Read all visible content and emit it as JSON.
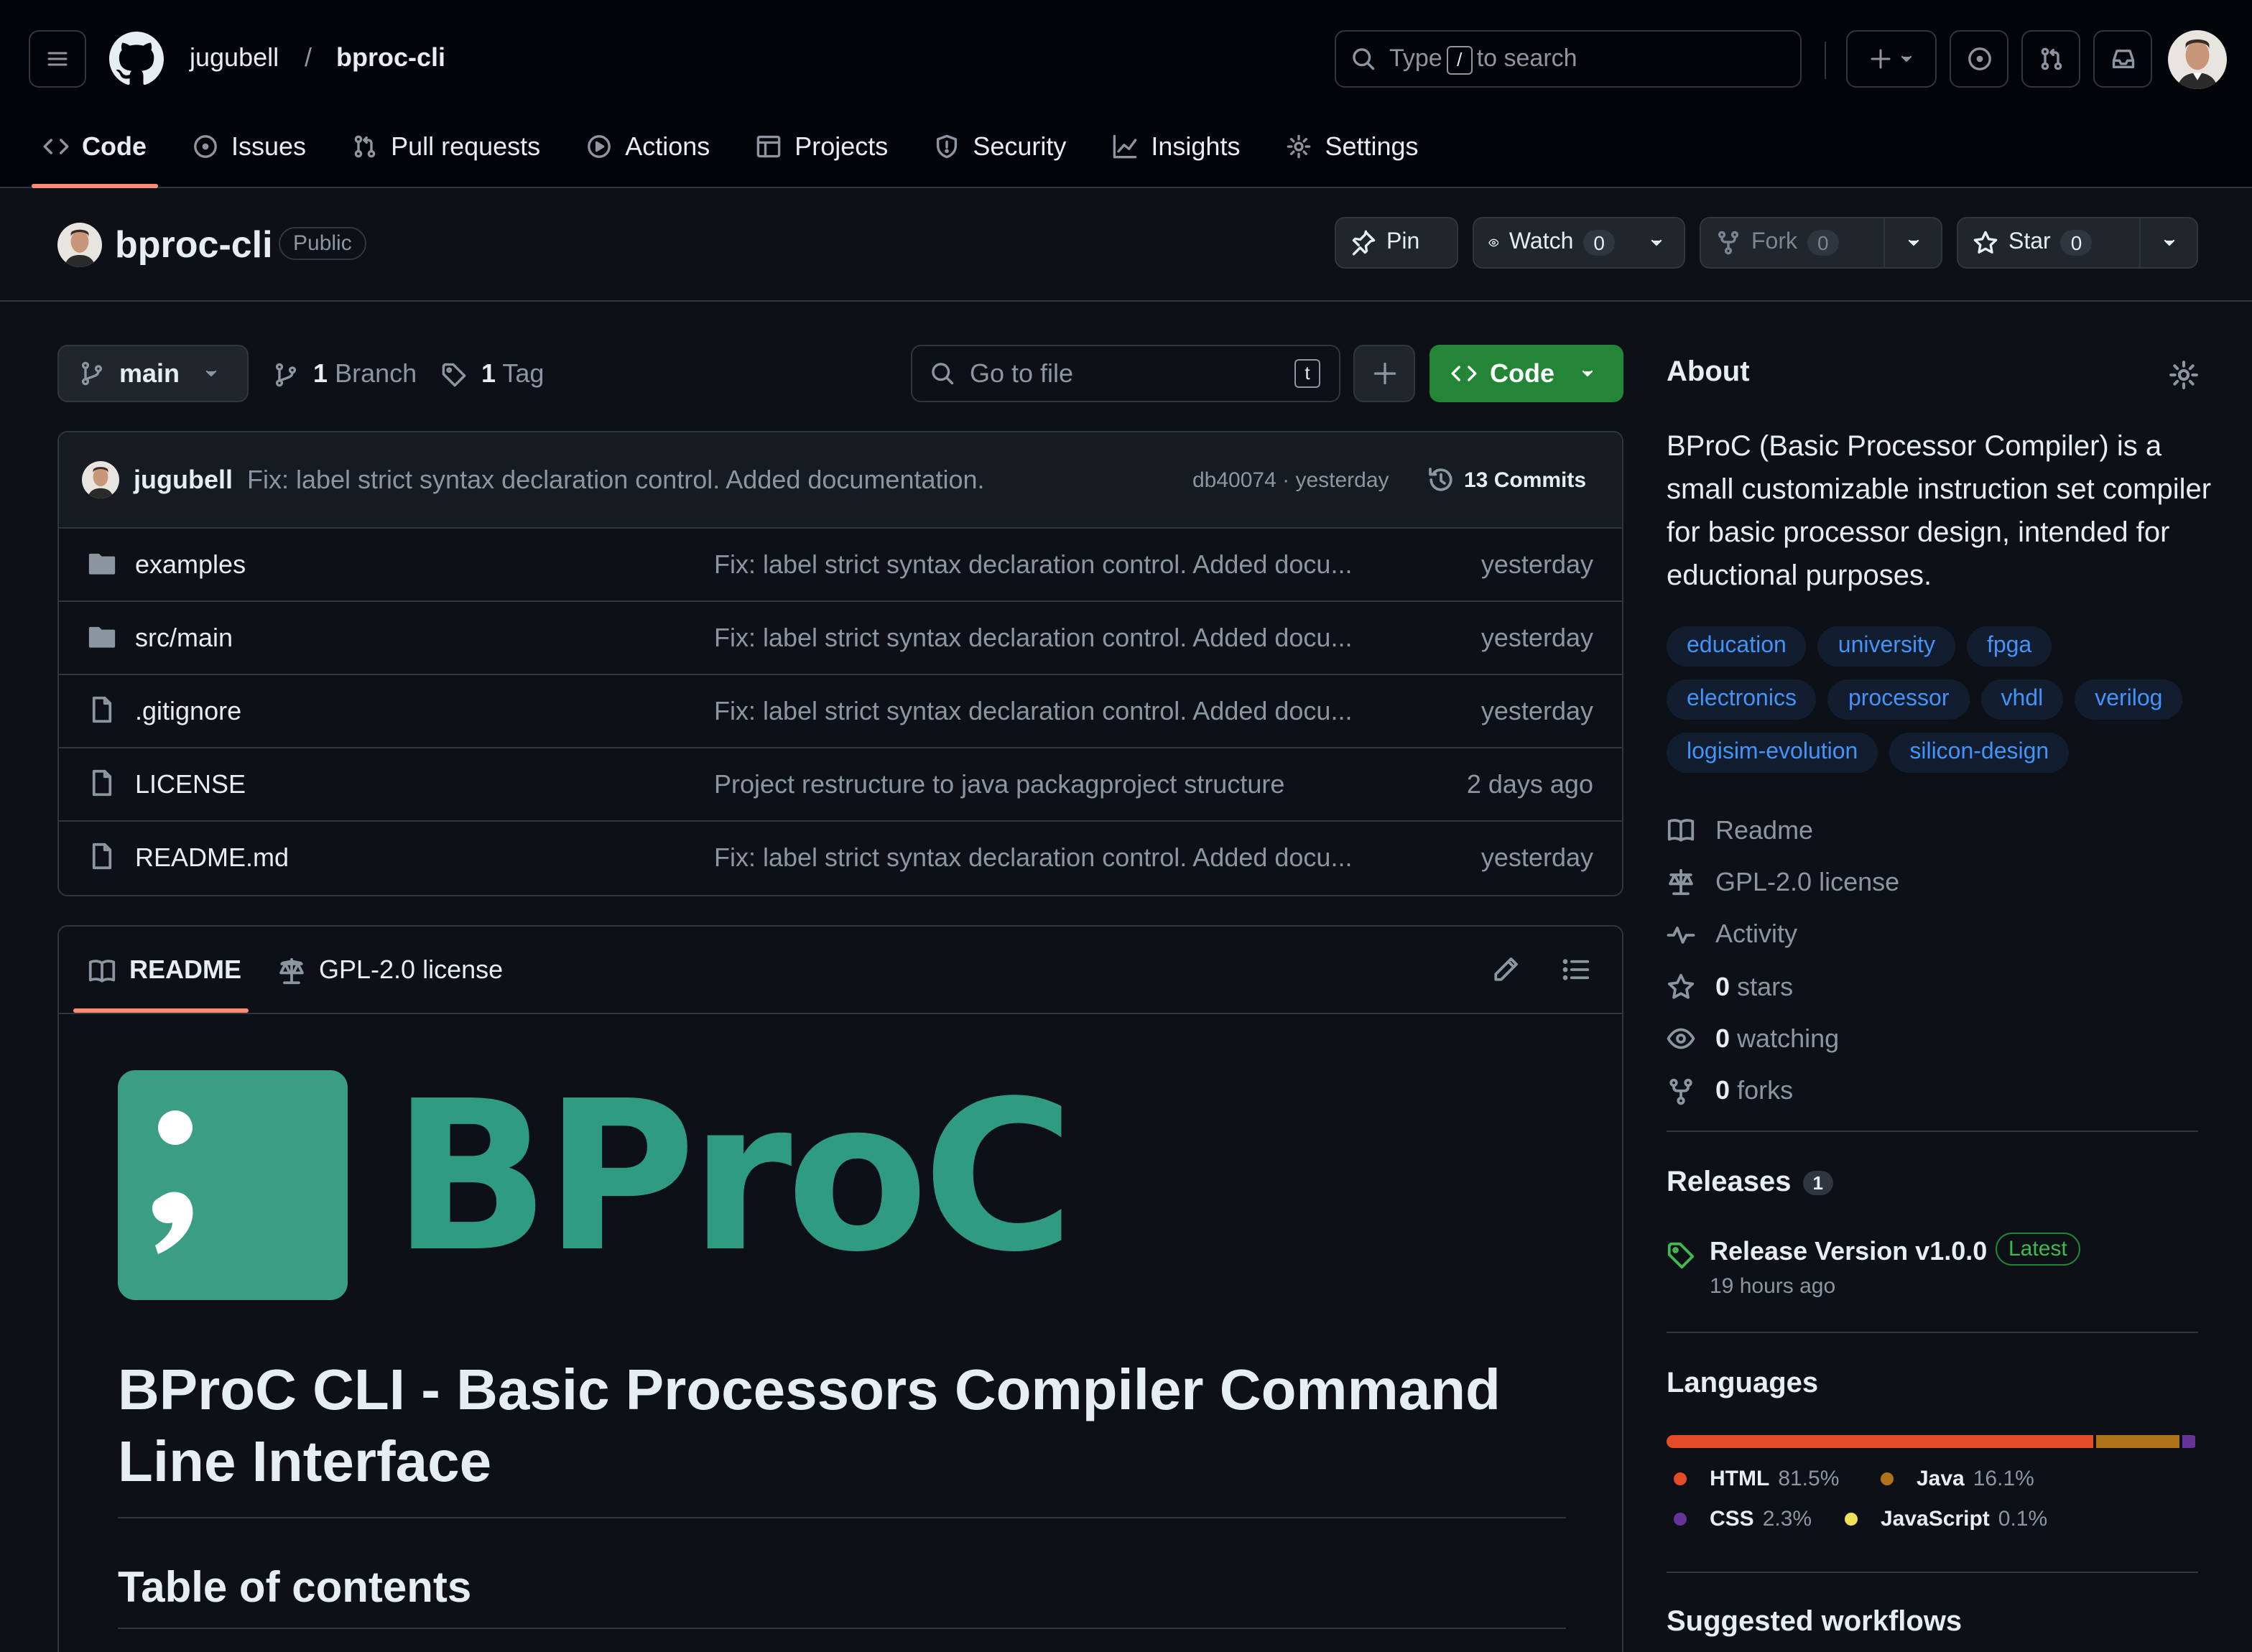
{
  "header": {
    "owner": "jugubell",
    "separator": "/",
    "repo": "bproc-cli",
    "search": {
      "prefix": "Type",
      "key": "/",
      "suffix": "to search"
    }
  },
  "tabs": [
    {
      "label": "Code",
      "icon": "code-icon",
      "active": true
    },
    {
      "label": "Issues",
      "icon": "issue-icon"
    },
    {
      "label": "Pull requests",
      "icon": "pull-request-icon"
    },
    {
      "label": "Actions",
      "icon": "play-icon"
    },
    {
      "label": "Projects",
      "icon": "table-icon"
    },
    {
      "label": "Security",
      "icon": "shield-icon"
    },
    {
      "label": "Insights",
      "icon": "graph-icon"
    },
    {
      "label": "Settings",
      "icon": "gear-icon"
    }
  ],
  "repo_bar": {
    "name": "bproc-cli",
    "visibility": "Public",
    "pin": "Pin",
    "watch": {
      "label": "Watch",
      "count": "0"
    },
    "fork": {
      "label": "Fork",
      "count": "0"
    },
    "star": {
      "label": "Star",
      "count": "0"
    }
  },
  "toolbar": {
    "branch": "main",
    "branches": {
      "count": "1",
      "label": "Branch"
    },
    "tags": {
      "count": "1",
      "label": "Tag"
    },
    "goto_placeholder": "Go to file",
    "goto_key": "t",
    "code_label": "Code"
  },
  "latest_commit": {
    "author": "jugubell",
    "message": "Fix: label strict syntax declaration control. Added documentation.",
    "sha_time": "db40074 · yesterday",
    "commits": "13 Commits"
  },
  "files": [
    {
      "name": "examples",
      "type": "folder",
      "message": "Fix: label strict syntax declaration control. Added docu...",
      "time": "yesterday"
    },
    {
      "name": "src/main",
      "type": "folder",
      "message": "Fix: label strict syntax declaration control. Added docu...",
      "time": "yesterday"
    },
    {
      "name": ".gitignore",
      "type": "file",
      "message": "Fix: label strict syntax declaration control. Added docu...",
      "time": "yesterday"
    },
    {
      "name": "LICENSE",
      "type": "file",
      "message": "Project restructure to java packagproject structure",
      "time": "2 days ago"
    },
    {
      "name": "README.md",
      "type": "file",
      "message": "Fix: label strict syntax declaration control. Added docu...",
      "time": "yesterday"
    }
  ],
  "readme": {
    "tab_readme": "README",
    "tab_license": "GPL-2.0 license",
    "logo_text": "BProC",
    "h1": "BProC CLI - Basic Processors Compiler Command Line Interface",
    "h2": "Table of contents"
  },
  "about": {
    "title": "About",
    "description": "BProC (Basic Processor Compiler) is a small customizable instruction set compiler for basic processor design, intended for eductional purposes.",
    "topics": [
      "education",
      "university",
      "fpga",
      "electronics",
      "processor",
      "vhdl",
      "verilog",
      "logisim-evolution",
      "silicon-design"
    ],
    "links": [
      {
        "icon": "book-icon",
        "bold": "",
        "label": "Readme"
      },
      {
        "icon": "law-icon",
        "bold": "",
        "label": "GPL-2.0 license"
      },
      {
        "icon": "pulse-icon",
        "bold": "",
        "label": "Activity"
      },
      {
        "icon": "star-icon",
        "bold": "0",
        "label": "stars"
      },
      {
        "icon": "eye-icon",
        "bold": "0",
        "label": "watching"
      },
      {
        "icon": "fork-icon",
        "bold": "0",
        "label": "forks"
      }
    ]
  },
  "releases": {
    "title": "Releases",
    "count": "1",
    "name": "Release Version v1.0.0",
    "badge": "Latest",
    "time": "19 hours ago"
  },
  "languages": {
    "title": "Languages",
    "items": [
      {
        "name": "HTML",
        "percent": "81.5%",
        "value": 81.5,
        "color": "#e34c26"
      },
      {
        "name": "Java",
        "percent": "16.1%",
        "value": 16.1,
        "color": "#b07219"
      },
      {
        "name": "CSS",
        "percent": "2.3%",
        "value": 2.3,
        "color": "#663399"
      },
      {
        "name": "JavaScript",
        "percent": "0.1%",
        "value": 0.1,
        "color": "#f1e05a"
      }
    ]
  },
  "suggested": {
    "title": "Suggested workflows"
  }
}
